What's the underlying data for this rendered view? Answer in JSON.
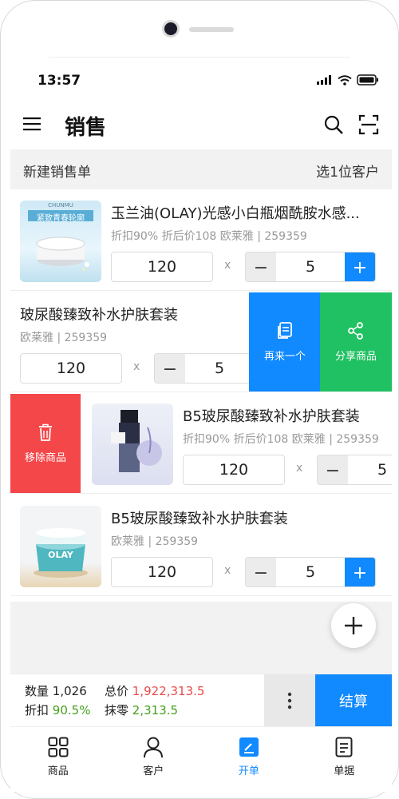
{
  "status_bar": {
    "time": "13:57"
  },
  "header": {
    "title": "销售"
  },
  "sub_header": {
    "left": "新建销售单",
    "right": "选1位客户"
  },
  "rows": [
    {
      "name": "玉兰油(OLAY)光感小白瓶烟酰胺水感...",
      "meta": "折扣90%  折后价108  欧莱雅  |  259359",
      "price": "120",
      "qty": "5",
      "thumb_text_top": "CHUNMU",
      "thumb_text_banner": "紧致青春轮廓"
    },
    {
      "name": "玻尿酸臻致补水护肤套装",
      "meta": "欧莱雅  |  259359",
      "price": "120",
      "qty": "5"
    },
    {
      "name": "B5玻尿酸臻致补水护肤套装",
      "meta": "折扣90%  折后价108  欧莱雅  |  259359",
      "price": "120",
      "qty": "5"
    },
    {
      "name": "B5玻尿酸臻致补水护肤套装",
      "meta": "欧莱雅  |  259359",
      "price": "120",
      "qty": "5",
      "thumb_text": "OLAY"
    }
  ],
  "row_symbols": {
    "times": "x",
    "minus": "−",
    "plus": "+"
  },
  "swipe_actions": {
    "again": "再来一个",
    "share": "分享商品",
    "remove": "移除商品"
  },
  "summary": {
    "qty_label": "数量",
    "qty_value": "1,026",
    "total_label": "总价",
    "total_value": "1,922,313.5",
    "discount_label": "折扣",
    "discount_value": "90.5%",
    "rounding_label": "抹零",
    "rounding_value": "2,313.5",
    "checkout": "结算"
  },
  "tabs": [
    {
      "label": "商品",
      "icon": "grid-icon"
    },
    {
      "label": "客户",
      "icon": "person-icon"
    },
    {
      "label": "开单",
      "icon": "edit-icon",
      "active": true
    },
    {
      "label": "单据",
      "icon": "document-icon"
    }
  ],
  "colors": {
    "accent": "#1189ff",
    "share": "#20c162",
    "remove": "#f4474a",
    "price_red": "#e84a4a",
    "discount_green": "#43a11b"
  }
}
